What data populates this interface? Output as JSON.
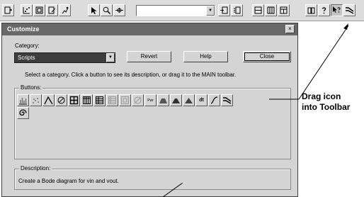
{
  "dialog": {
    "title": "Customize",
    "close_glyph": "×",
    "category_label": "Category:",
    "category_value": "Scripts",
    "revert_label": "Revert",
    "help_label": "Help",
    "close_label": "Close",
    "instructions": "Select a category. Click a button to see its description, or drag it to the MAIN toolbar.",
    "buttons_group_label": "Buttons:",
    "description_group_label": "Description:",
    "description_text": "Create a Bode diagram for vin and vout.",
    "pwr_label": "Pwr",
    "level_label": "dt"
  },
  "annotation": {
    "line1": "Drag icon",
    "line2": "into Toolbar"
  },
  "toolbar_icons": [
    "new-file-icon",
    "scatter-icon",
    "frame-icon",
    "edit-icon",
    "run-icon",
    "pointer-icon",
    "zoom-icon",
    "probe-icon",
    "combo-box",
    "insert-icon",
    "import-icon",
    "split-horizontal-icon",
    "split-vertical-icon",
    "split-window-icon",
    "book-icon",
    "help-icon",
    "context-help-icon",
    "bode-icon"
  ],
  "button_icons": [
    "bar-chart-icon",
    "scatter-icon",
    "line-icon",
    "ellipse-icon",
    "grid-icon",
    "table-icon",
    "table2-icon",
    "list-icon",
    "frame-icon",
    "no-signal-icon",
    "pwr-icon",
    "mountain1-icon",
    "mountain2-icon",
    "mountain3-icon",
    "level-icon",
    "ramp-icon",
    "bode-icon",
    "spiral-icon"
  ]
}
